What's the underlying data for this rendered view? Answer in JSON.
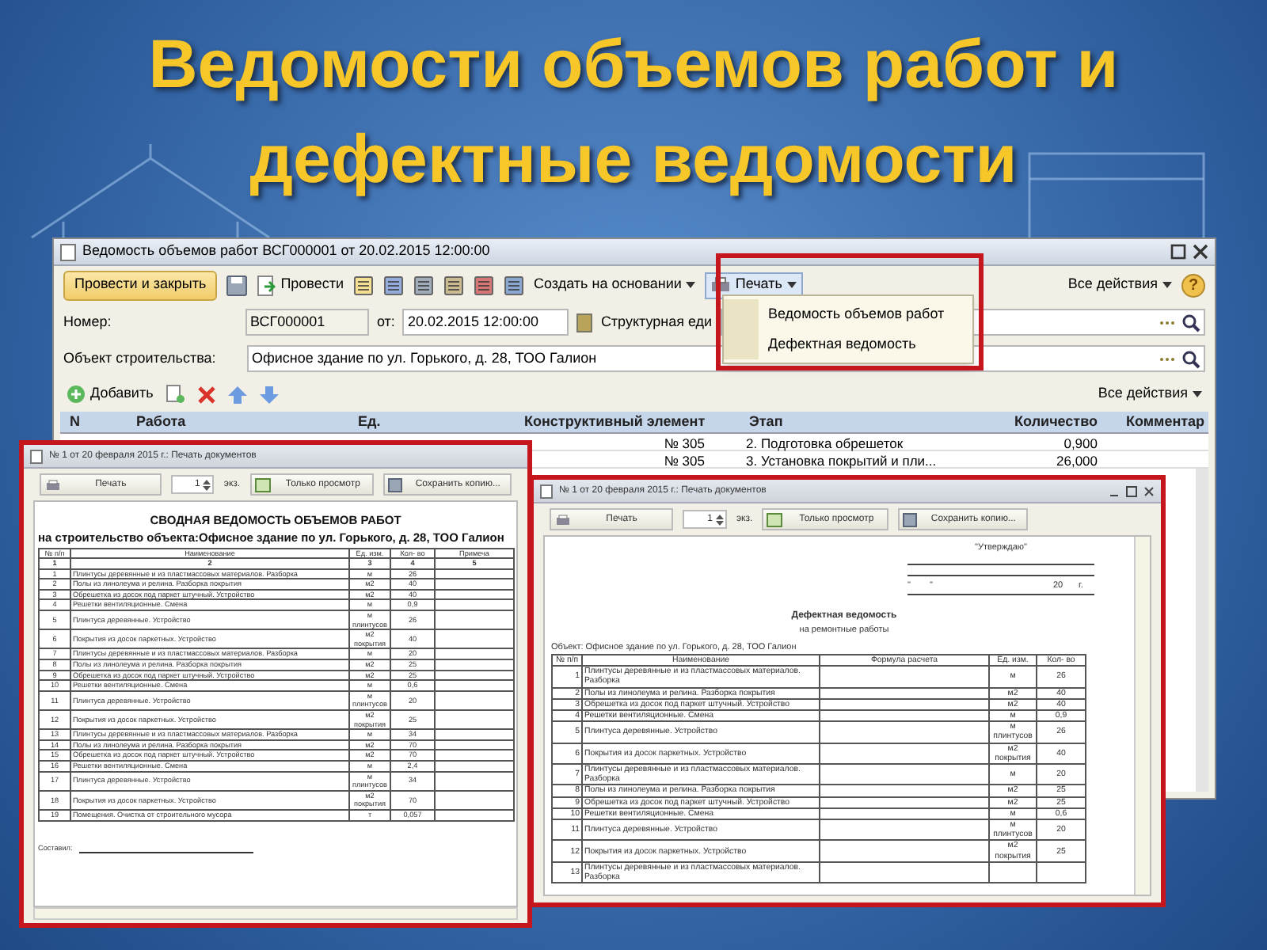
{
  "slide": {
    "title_lines": [
      "Ведомости объемов работ и",
      "дефектные ведомости"
    ]
  },
  "main_window": {
    "title": "Ведомость объемов работ ВСГ000001 от 20.02.2015 12:00:00",
    "toolbar": {
      "post_close": "Провести и закрыть",
      "post": "Провести",
      "create_based": "Создать на основании",
      "print": "Печать",
      "all_actions": "Все действия",
      "help": "?"
    },
    "print_menu": [
      {
        "label": "Ведомость объемов работ"
      },
      {
        "label": "Дефектная ведомость"
      }
    ],
    "number_label": "Номер:",
    "number": "ВСГ000001",
    "date_label": "от:",
    "date": "20.02.2015 12:00:00",
    "unit_label": "Структурная еди",
    "object_label": "Объект строительства:",
    "object": "Офисное здание по ул. Горького, д. 28, ТОО Галион",
    "table_toolbar": {
      "add": "Добавить",
      "all_actions": "Все действия"
    },
    "columns": [
      "N",
      "Работа",
      "Ед.",
      "Конструктивный элемент",
      "Этап",
      "Количество",
      "Комментар"
    ],
    "rows": [
      {
        "element": "№ 305",
        "stage": "2. Подготовка обрешеток",
        "qty": "0,900"
      },
      {
        "element": "№ 305",
        "stage": "3. Установка покрытий и пли...",
        "qty": "26,000"
      }
    ]
  },
  "summary_print_window": {
    "title": "№ 1 от 20 февраля 2015 г.: Печать документов",
    "toolbar": {
      "print": "Печать",
      "copies": "1",
      "units": "экз.",
      "preview": "Только просмотр",
      "save": "Сохранить копию..."
    },
    "heading": "СВОДНАЯ ВЕДОМОСТЬ ОБЪЕМОВ РАБОТ",
    "subheading": "на строительство объекта:Офисное здание по ул. Горького, д. 28, ТОО Галион",
    "columns": [
      "№ п/п",
      "Наименование",
      "Ед. изм.",
      "Кол- во",
      "Примеча"
    ],
    "column_numbers": [
      "1",
      "2",
      "3",
      "4",
      "5"
    ],
    "rows": [
      {
        "no": "1",
        "name": "Плинтусы деревянные и из пластмассовых материалов. Разборка",
        "unit": "м",
        "qty": "26"
      },
      {
        "no": "2",
        "name": "Полы из линолеума и релина. Разборка покрытия",
        "unit": "м2",
        "qty": "40"
      },
      {
        "no": "3",
        "name": "Обрешетка из досок под паркет штучный. Устройство",
        "unit": "м2",
        "qty": "40"
      },
      {
        "no": "4",
        "name": "Решетки вентиляционные. Смена",
        "unit": "м",
        "qty": "0,9"
      },
      {
        "no": "5",
        "name": "Плинтуса деревянные. Устройство",
        "unit": "м плинтусов",
        "qty": "26"
      },
      {
        "no": "6",
        "name": "Покрытия из досок паркетных. Устройство",
        "unit": "м2 покрытия",
        "qty": "40"
      },
      {
        "no": "7",
        "name": "Плинтусы деревянные и из пластмассовых материалов. Разборка",
        "unit": "м",
        "qty": "20"
      },
      {
        "no": "8",
        "name": "Полы из линолеума и релина. Разборка покрытия",
        "unit": "м2",
        "qty": "25"
      },
      {
        "no": "9",
        "name": "Обрешетка из досок под паркет штучный. Устройство",
        "unit": "м2",
        "qty": "25"
      },
      {
        "no": "10",
        "name": "Решетки вентиляционные. Смена",
        "unit": "м",
        "qty": "0,6"
      },
      {
        "no": "11",
        "name": "Плинтуса деревянные. Устройство",
        "unit": "м плинтусов",
        "qty": "20"
      },
      {
        "no": "12",
        "name": "Покрытия из досок паркетных. Устройство",
        "unit": "м2 покрытия",
        "qty": "25"
      },
      {
        "no": "13",
        "name": "Плинтусы деревянные и из пластмассовых материалов. Разборка",
        "unit": "м",
        "qty": "34"
      },
      {
        "no": "14",
        "name": "Полы из линолеума и релина. Разборка покрытия",
        "unit": "м2",
        "qty": "70"
      },
      {
        "no": "15",
        "name": "Обрешетка из досок под паркет штучный. Устройство",
        "unit": "м2",
        "qty": "70"
      },
      {
        "no": "16",
        "name": "Решетки вентиляционные. Смена",
        "unit": "м",
        "qty": "2,4"
      },
      {
        "no": "17",
        "name": "Плинтуса деревянные. Устройство",
        "unit": "м плинтусов",
        "qty": "34"
      },
      {
        "no": "18",
        "name": "Покрытия из досок паркетных. Устройство",
        "unit": "м2 покрытия",
        "qty": "70"
      },
      {
        "no": "19",
        "name": "Помещения. Очистка от строительного мусора",
        "unit": "т",
        "qty": "0,057"
      }
    ],
    "signature_label": "Составил:"
  },
  "defect_print_window": {
    "title": "№ 1 от 20 февраля 2015 г.: Печать документов",
    "toolbar": {
      "print": "Печать",
      "copies": "1",
      "units": "экз.",
      "preview": "Только просмотр",
      "save": "Сохранить копию..."
    },
    "approve": "\"Утверждаю\"",
    "date_parts": [
      "\"",
      "\"",
      "20",
      "г."
    ],
    "heading": "Дефектная ведомость",
    "subheading": "на ремонтные работы",
    "object": "Объект: Офисное здание по ул. Горького, д. 28, ТОО Галион",
    "columns": [
      "№ п/п",
      "Наименование",
      "Формула расчета",
      "Ед. изм.",
      "Кол- во"
    ],
    "rows": [
      {
        "no": "1",
        "name": "Плинтусы деревянные и из пластмассовых материалов. Разборка",
        "unit": "м",
        "qty": "26"
      },
      {
        "no": "2",
        "name": "Полы из линолеума и релина. Разборка покрытия",
        "unit": "м2",
        "qty": "40"
      },
      {
        "no": "3",
        "name": "Обрешетка из досок под паркет штучный. Устройство",
        "unit": "м2",
        "qty": "40"
      },
      {
        "no": "4",
        "name": "Решетки вентиляционные. Смена",
        "unit": "м",
        "qty": "0,9"
      },
      {
        "no": "5",
        "name": "Плинтуса деревянные. Устройство",
        "unit": "м плинтусов",
        "qty": "26"
      },
      {
        "no": "6",
        "name": "Покрытия из досок паркетных. Устройство",
        "unit": "м2 покрытия",
        "qty": "40"
      },
      {
        "no": "7",
        "name": "Плинтусы деревянные и из пластмассовых материалов. Разборка",
        "unit": "м",
        "qty": "20"
      },
      {
        "no": "8",
        "name": "Полы из линолеума и релина. Разборка покрытия",
        "unit": "м2",
        "qty": "25"
      },
      {
        "no": "9",
        "name": "Обрешетка из досок под паркет штучный. Устройство",
        "unit": "м2",
        "qty": "25"
      },
      {
        "no": "10",
        "name": "Решетки вентиляционные. Смена",
        "unit": "м",
        "qty": "0,6"
      },
      {
        "no": "11",
        "name": "Плинтуса деревянные. Устройство",
        "unit": "м плинтусов",
        "qty": "20"
      },
      {
        "no": "12",
        "name": "Покрытия из досок паркетных. Устройство",
        "unit": "м2 покрытия",
        "qty": "25"
      },
      {
        "no": "13",
        "name": "Плинтусы деревянные и из пластмассовых материалов. Разборка"
      }
    ]
  }
}
